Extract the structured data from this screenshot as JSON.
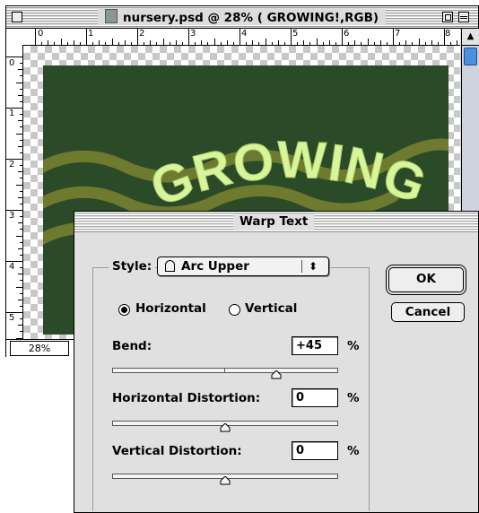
{
  "document": {
    "title": "nursery.psd @ 28% ( GROWING!,RGB)",
    "artwork_text": "GROWING!",
    "zoom": "28%",
    "ruler_top_labels": [
      "0",
      "1",
      "2",
      "3",
      "4",
      "5",
      "6",
      "7",
      "8"
    ],
    "ruler_left_labels": [
      "0",
      "1",
      "2",
      "3",
      "4",
      "5"
    ],
    "canvas_color": "#2a4a28",
    "wave_color": "#6e7a2e",
    "text_color": "#d8f59a"
  },
  "dialog": {
    "title": "Warp Text",
    "style_label": "Style:",
    "style_value": "Arc Upper",
    "style_arrows": "⬍",
    "orientation": {
      "horizontal_label": "Horizontal",
      "vertical_label": "Vertical",
      "selected": "Horizontal"
    },
    "bend": {
      "label": "Bend:",
      "value": "+45",
      "unit": "%",
      "level": 0.725
    },
    "horizontal_distortion": {
      "label": "Horizontal Distortion:",
      "value": "0",
      "unit": "%",
      "level": 0.5
    },
    "vertical_distortion": {
      "label": "Vertical Distortion:",
      "value": "0",
      "unit": "%",
      "level": 0.5
    },
    "ok_label": "OK",
    "cancel_label": "Cancel"
  }
}
